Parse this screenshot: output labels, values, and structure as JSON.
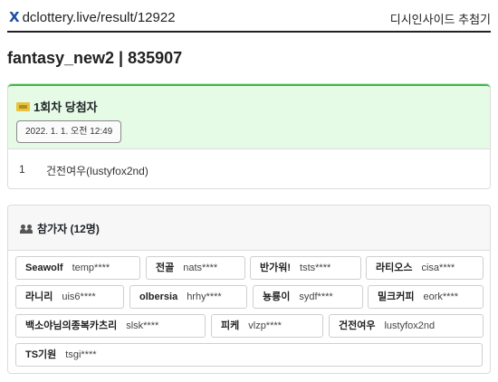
{
  "header": {
    "brand_icon": "X",
    "url": "dclottery.live/result/12922",
    "right_text": "디시인사이드 추첨기"
  },
  "page_title": "fantasy_new2 | 835907",
  "winners": {
    "title": "1회차 당첨자",
    "date": "2022. 1. 1. 오전 12:49",
    "rows": [
      {
        "rank": "1",
        "name": "건전여우(lustyfox2nd)"
      }
    ]
  },
  "participants": {
    "title": "참가자 (12명)",
    "items": [
      {
        "nick": "Seawolf",
        "id": "temp****"
      },
      {
        "nick": "전골",
        "id": "nats****"
      },
      {
        "nick": "반가워!",
        "id": "tsts****"
      },
      {
        "nick": "라티오스",
        "id": "cisa****"
      },
      {
        "nick": "라니리",
        "id": "uis6****"
      },
      {
        "nick": "olbersia",
        "id": "hrhy****"
      },
      {
        "nick": "뇽룡이",
        "id": "sydf****"
      },
      {
        "nick": "밀크커피",
        "id": "eork****"
      },
      {
        "nick": "백소야님의종복카츠리",
        "id": "slsk****"
      },
      {
        "nick": "피케",
        "id": "vlzp****"
      },
      {
        "nick": "건전여우",
        "id": "lustyfox2nd"
      },
      {
        "nick": "TS기원",
        "id": "tsgi****"
      }
    ]
  },
  "colors": {
    "winners_header_bg": "#e6fbe6",
    "winners_accent": "#3cb84a",
    "brand_icon": "#1a4fa3"
  }
}
